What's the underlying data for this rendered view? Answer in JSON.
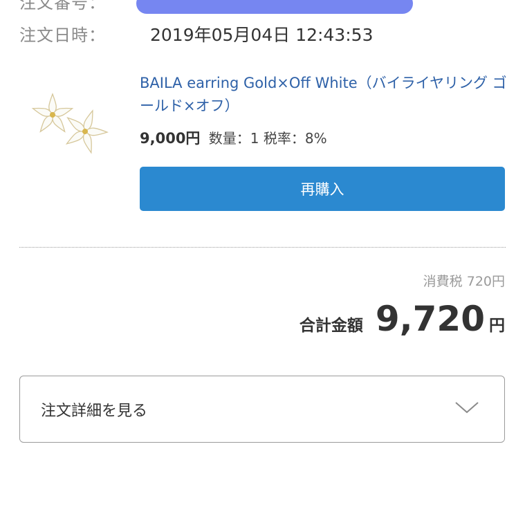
{
  "order": {
    "number_label": "注文番号：",
    "date_label": "注文日時：",
    "date_value": "2019年05月04日 12:43:53"
  },
  "item": {
    "thumbnail_icon": "flower-earring-image",
    "name": "BAILA earring Gold×Off White（バイライヤリング ゴールド×オフ）",
    "price": "9,000円",
    "quantity_text": "数量：1",
    "tax_rate_text": "税率：8%",
    "rebuy_label": "再購入"
  },
  "summary": {
    "tax_label": "消費税",
    "tax_value": "720円",
    "total_label": "合計金額",
    "total_amount": "9,720",
    "total_unit": "円"
  },
  "details": {
    "toggle_label": "注文詳細を見る",
    "toggle_icon": "chevron-down-icon"
  },
  "colors": {
    "link_blue": "#2e61a8",
    "button_blue": "#2b89d0",
    "redaction": "#6f7ff0"
  }
}
